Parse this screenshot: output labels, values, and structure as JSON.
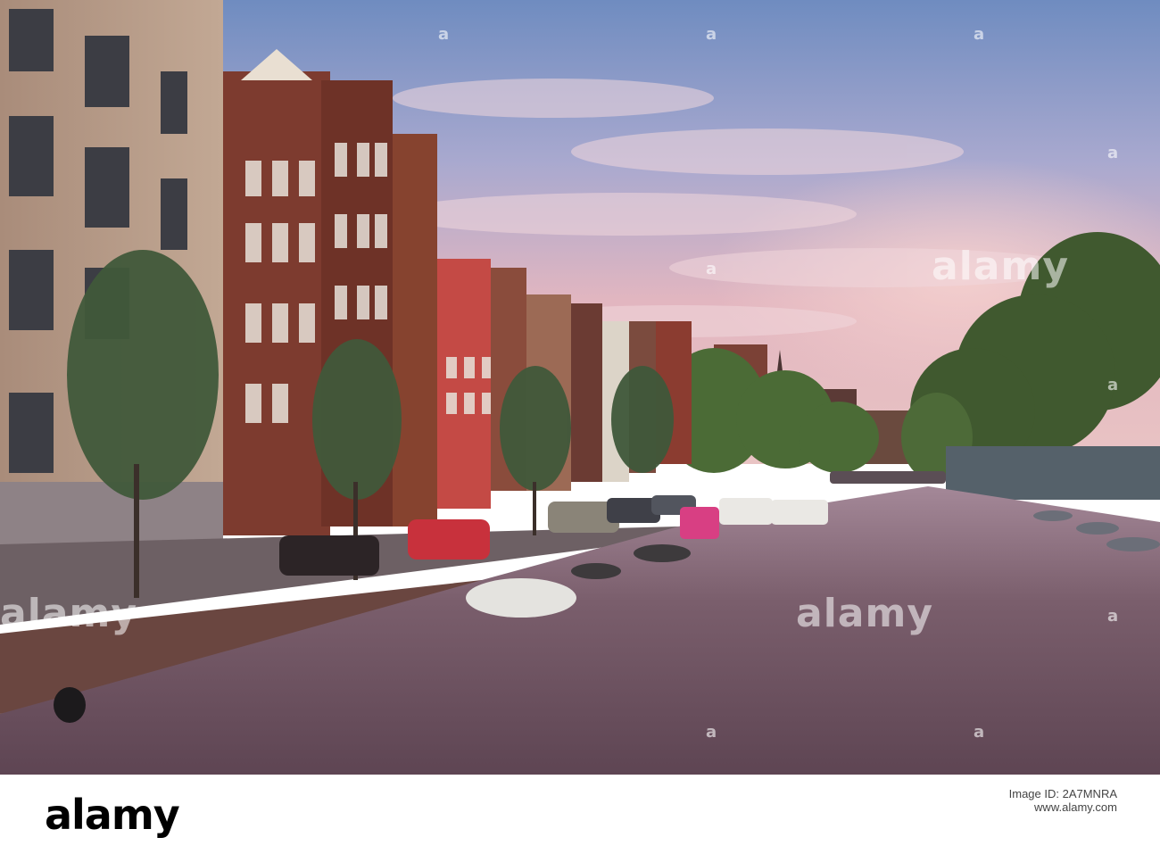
{
  "photo": {
    "subject": "Amsterdam canal at dusk with gabled canal houses, parked cars, moored boats and a tree-lined bank",
    "colors": {
      "sky_top": "#6a86b8",
      "sky_mid": "#b8a7c4",
      "sky_pink": "#e6b7bf",
      "water": "#6b5361",
      "water_light": "#a58896",
      "brick": "#7a3b2e",
      "stone": "#b79a86",
      "tree": "#3f5a2c"
    }
  },
  "watermark": {
    "text": "alamy",
    "small_text": "a"
  },
  "footer": {
    "logo": "alamy",
    "id_label": "Image ID: 2A7MNRA",
    "id": "2A7MNRA",
    "url": "www.alamy.com"
  }
}
